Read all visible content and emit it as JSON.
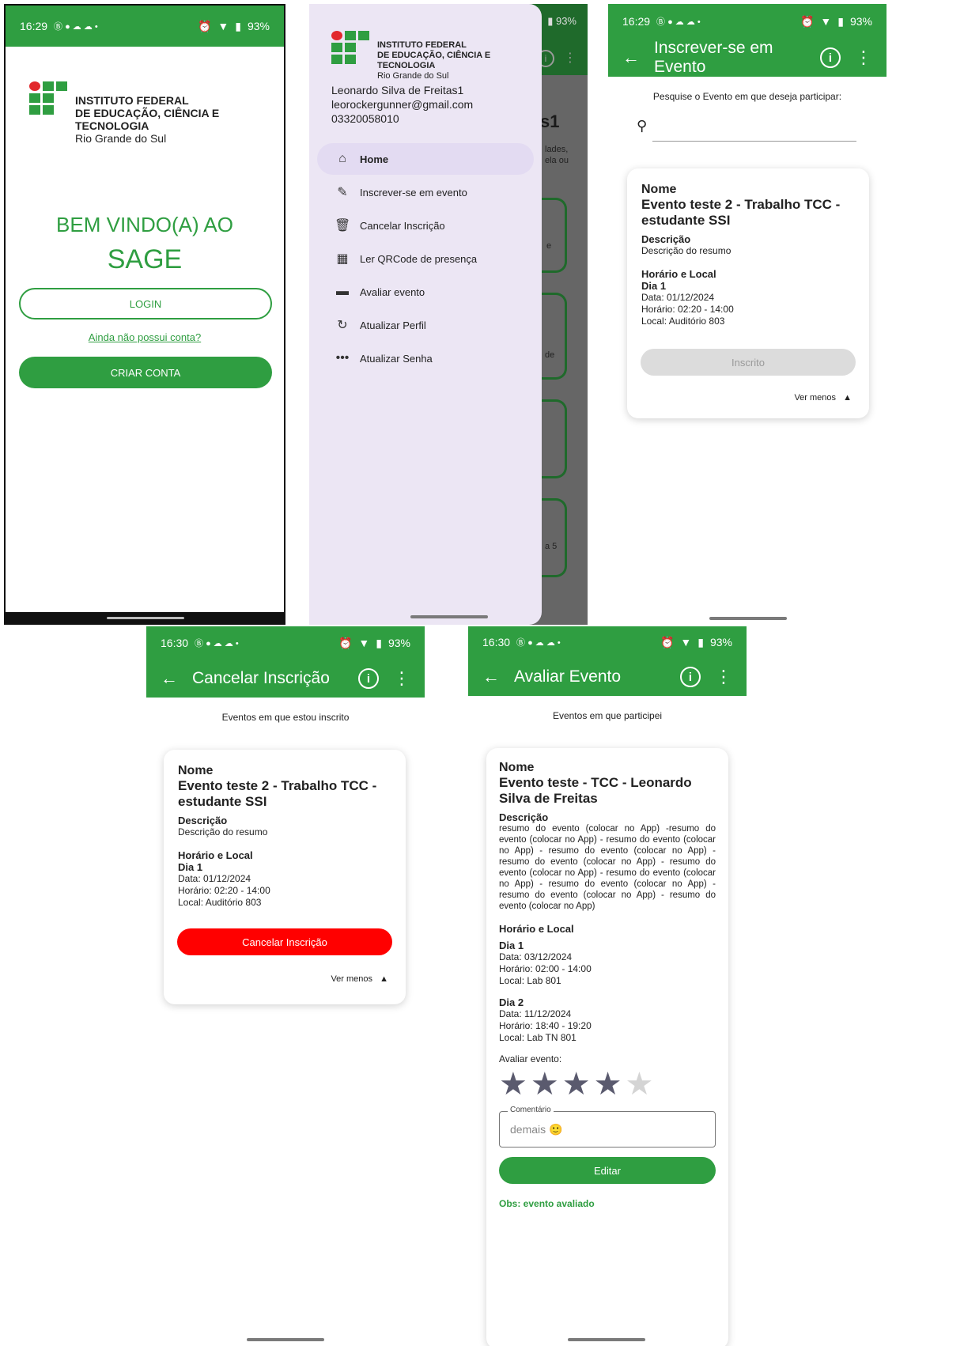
{
  "colors": {
    "green": "#2f9e41",
    "red": "#ff0000",
    "drawer_bg": "#ece6f4",
    "scrim": "#666666"
  },
  "logo": {
    "line1": "INSTITUTO FEDERAL",
    "line2": "DE EDUCAÇÃO, CIÊNCIA E TECNOLOGIA",
    "line3": "Rio Grande do Sul"
  },
  "login": {
    "status": {
      "time": "16:29",
      "icons": "Ⓑ ● ☁ ☁ •",
      "battery": "93%"
    },
    "welcome": "BEM VINDO(A) AO",
    "app_name": "SAGE",
    "login_button": "LOGIN",
    "no_account_link": "Ainda não possui conta?",
    "create_button": "CRIAR CONTA"
  },
  "drawer": {
    "battery": "93%",
    "user_name": "Leonardo Silva de Freitas1",
    "user_email": "leorockergunner@gmail.com",
    "user_id": "03320058010",
    "items": [
      {
        "label": "Home",
        "icon": "home-icon"
      },
      {
        "label": "Inscrever-se em evento",
        "icon": "edit-icon"
      },
      {
        "label": "Cancelar Inscrição",
        "icon": "trash-icon"
      },
      {
        "label": "Ler QRCode de presença",
        "icon": "qrcode-icon"
      },
      {
        "label": "Avaliar evento",
        "icon": "rating-icon"
      },
      {
        "label": "Atualizar Perfil",
        "icon": "refresh-user-icon"
      },
      {
        "label": "Atualizar Senha",
        "icon": "password-icon"
      }
    ],
    "behind": {
      "title_fragment": "s1",
      "text1": "lades,",
      "text2": "ela ou",
      "t_e": "e",
      "t_de": "de",
      "t_a5": "a 5"
    }
  },
  "subscribe": {
    "status": {
      "time": "16:29",
      "icons": "Ⓑ ● ☁ ☁ •",
      "battery": "93%"
    },
    "title": "Inscrever-se em Evento",
    "prompt": "Pesquise o Evento em que deseja participar:",
    "search_placeholder": "",
    "card": {
      "name_label": "Nome",
      "name": "Evento teste 2 - Trabalho TCC - estudante SSI",
      "desc_label": "Descrição",
      "desc": "Descrição do resumo",
      "time_label": "Horário e Local",
      "day": "Dia 1",
      "date": "Data: 01/12/2024",
      "hours": "Horário: 02:20 - 14:00",
      "place": "Local: Auditório 803",
      "button": "Inscrito",
      "toggle": "Ver menos"
    }
  },
  "cancel": {
    "status": {
      "time": "16:30",
      "icons": "Ⓑ ● ☁ ☁ •",
      "battery": "93%"
    },
    "title": "Cancelar Inscrição",
    "subtitle": "Eventos em que estou inscrito",
    "card": {
      "name_label": "Nome",
      "name": "Evento teste 2 - Trabalho TCC - estudante SSI",
      "desc_label": "Descrição",
      "desc": "Descrição do resumo",
      "time_label": "Horário e Local",
      "day": "Dia 1",
      "date": "Data: 01/12/2024",
      "hours": "Horário: 02:20 - 14:00",
      "place": "Local: Auditório 803",
      "button": "Cancelar Inscrição",
      "toggle": "Ver menos"
    }
  },
  "evaluate": {
    "status": {
      "time": "16:30",
      "icons": "Ⓑ ● ☁ ☁ •",
      "battery": "93%"
    },
    "title": "Avaliar Evento",
    "subtitle": "Eventos em que participei",
    "card": {
      "name_label": "Nome",
      "name": "Evento teste - TCC - Leonardo Silva de Freitas",
      "desc_label": "Descrição",
      "desc": "resumo do evento (colocar no App) -resumo do evento (colocar no App) - resumo do evento (colocar no App) - resumo do evento (colocar no App) - resumo do evento (colocar no App) - resumo do evento (colocar no App) - resumo do evento (colocar no App) - resumo do evento (colocar no App) - resumo do evento (colocar no App) - resumo do evento (colocar no App)",
      "time_label": "Horário e Local",
      "day1": "Dia 1",
      "day1_date": "Data: 03/12/2024",
      "day1_hours": "Horário: 02:00 - 14:00",
      "day1_place": "Local: Lab 801",
      "day2": "Dia 2",
      "day2_date": "Data: 11/12/2024",
      "day2_hours": "Horário: 18:40 - 19:20",
      "day2_place": "Local: Lab TN 801",
      "rate_label": "Avaliar evento:",
      "rating": 4,
      "rating_max": 5,
      "comment_label": "Comentário",
      "comment_value": "demais 🙂",
      "button": "Editar",
      "note": "Obs: evento avaliado"
    }
  }
}
